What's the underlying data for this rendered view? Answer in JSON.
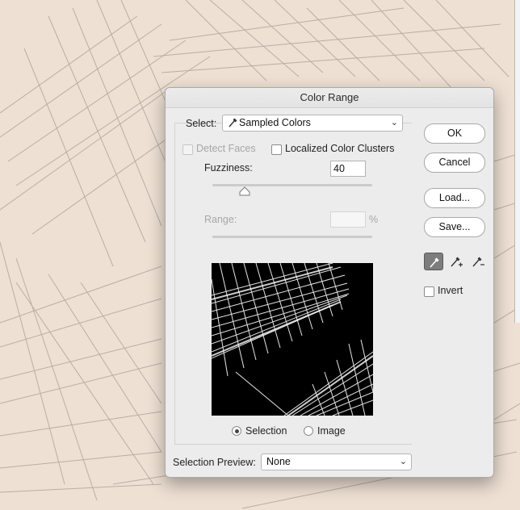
{
  "dialog": {
    "title": "Color Range",
    "select_label": "Select:",
    "select_value": "Sampled Colors",
    "detect_faces_label": "Detect Faces",
    "detect_faces_checked": false,
    "localized_label": "Localized Color Clusters",
    "localized_checked": false,
    "fuzziness_label": "Fuzziness:",
    "fuzziness_value": "40",
    "fuzziness_slider_level": 0.2,
    "range_label": "Range:",
    "range_value": "",
    "range_unit": "%",
    "view_options": [
      {
        "label": "Selection",
        "selected": true
      },
      {
        "label": "Image",
        "selected": false
      }
    ],
    "selection_preview_label": "Selection Preview:",
    "selection_preview_value": "None",
    "buttons": {
      "ok": "OK",
      "cancel": "Cancel",
      "load": "Load...",
      "save": "Save..."
    },
    "eyedroppers": [
      {
        "icon": "eyedropper-icon",
        "active": true
      },
      {
        "icon": "eyedropper-plus-icon",
        "active": false
      },
      {
        "icon": "eyedropper-minus-icon",
        "active": false
      }
    ],
    "invert_label": "Invert",
    "invert_checked": false
  },
  "colors": {
    "canvas_background": "#eee0d3",
    "dialog_background": "#ececec",
    "active_tool": "#7d7d7d"
  }
}
